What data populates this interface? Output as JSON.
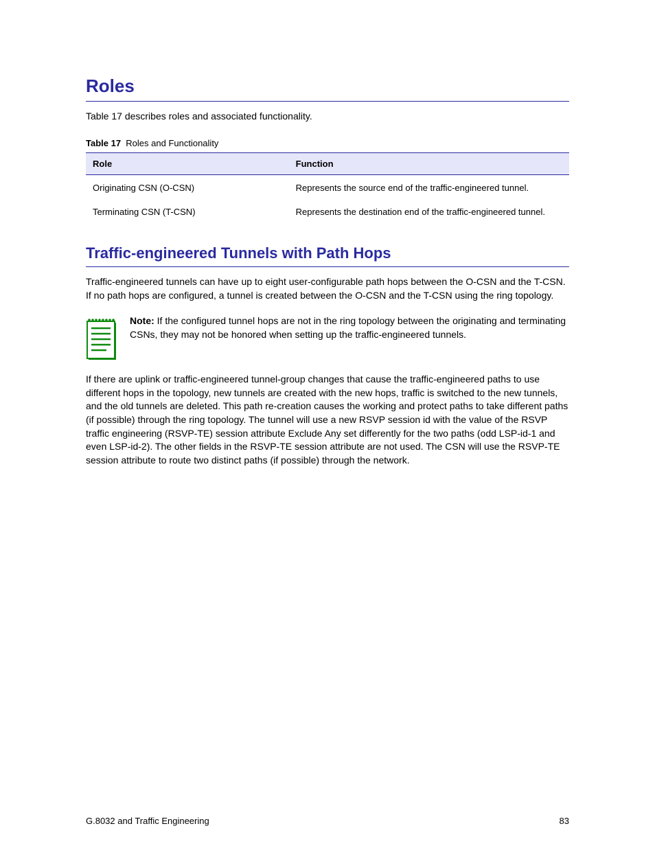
{
  "section": {
    "heading": "Roles",
    "intro_pre": "",
    "intro_link": "Table 17",
    "intro_post": " describes roles and associated functionality.",
    "table": {
      "caption_no": "Table 17",
      "caption_text": "Roles and Functionality",
      "col1_header": "Role",
      "col2_header": "Function",
      "rows": [
        {
          "role": "Originating CSN (O-CSN)",
          "function": "Represents the source end of the traffic-engineered tunnel."
        },
        {
          "role": "Terminating CSN (T-CSN)",
          "function": "Represents the destination end of the traffic-engineered tunnel."
        }
      ]
    }
  },
  "subsection": {
    "heading": "Traffic-engineered Tunnels with Path Hops",
    "p1": "Traffic-engineered tunnels can have up to eight user-configurable path hops between the O-CSN and the T-CSN. If no path hops are configured, a tunnel is created between the O-CSN and the T-CSN using the ring topology.",
    "note_label": "Note: ",
    "note_text": "If the configured tunnel hops are not in the ring topology between the originating and terminating CSNs, they may not be honored when setting up the traffic-engineered tunnels.",
    "p2": "If there are uplink or traffic-engineered tunnel-group changes that cause the traffic-engineered paths to use different hops in the topology, new tunnels are created with the new hops, traffic is switched to the new tunnels, and the old tunnels are deleted. This path re-creation causes the working and protect paths to take different paths (if possible) through the ring topology. The tunnel will use a new RSVP session id with the value of the RSVP traffic engineering (RSVP-TE) session attribute Exclude Any set differently for the two paths (odd LSP-id-1 and even LSP-id-2). The other fields in the RSVP-TE session attribute are not used. The CSN will use the RSVP-TE session attribute to route two distinct paths (if possible) through the network."
  },
  "footer": {
    "left": "G.8032 and Traffic Engineering",
    "right": "83"
  }
}
